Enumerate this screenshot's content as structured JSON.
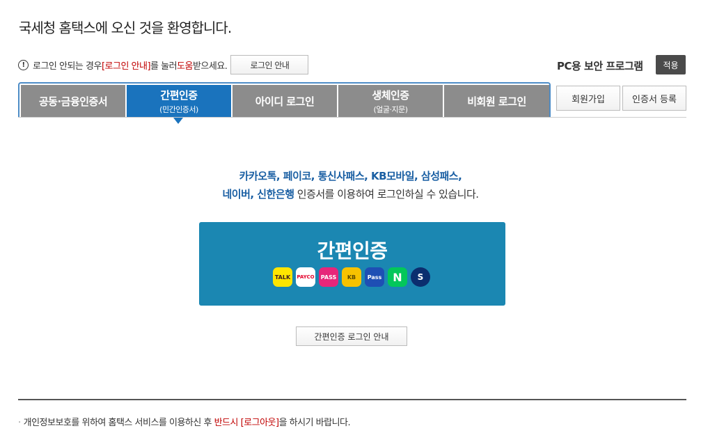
{
  "title": "국세청 홈택스에 오신 것을 환영합니다.",
  "help": {
    "text_1": "로그인 안되는 경우 ",
    "link_login_guide": "[로그인 안내]",
    "text_2": "를 눌러 ",
    "link_help": "도움",
    "text_3": "받으세요.",
    "button": "로그인 안내"
  },
  "security": {
    "label": "PC용 보안 프로그램",
    "button": "적용"
  },
  "tabs": [
    {
      "label": "공동·금융인증서",
      "sub": ""
    },
    {
      "label": "간편인증",
      "sub": "(민간인증서)"
    },
    {
      "label": "아이디 로그인",
      "sub": ""
    },
    {
      "label": "생체인증",
      "sub": "(얼굴·지문)"
    },
    {
      "label": "비회원 로그인",
      "sub": ""
    }
  ],
  "right_buttons": {
    "signup": "회원가입",
    "cert_register": "인증서 등록"
  },
  "description": {
    "providers_line1": "카카오톡, 페이코, 통신사패스, KB모바일, 삼성패스,",
    "providers_line2": "네이버, 신한은행",
    "suffix": " 인증서를 이용하여 로그인하실 수 있습니다."
  },
  "main_button": {
    "label": "간편인증",
    "logos": [
      {
        "name": "kakao-talk",
        "text": "TALK",
        "bg": "#fee500",
        "fg": "#3c1e1e"
      },
      {
        "name": "payco",
        "text": "PAYCO",
        "bg": "#ffffff",
        "fg": "#e4002b"
      },
      {
        "name": "pass",
        "text": "PASS",
        "bg": "#e6267a",
        "fg": "#ffffff"
      },
      {
        "name": "kb",
        "text": "KB",
        "bg": "#f7c200",
        "fg": "#5c4a00"
      },
      {
        "name": "samsung-pass",
        "text": "Pass",
        "bg": "#1e4fb4",
        "fg": "#ffffff"
      },
      {
        "name": "naver",
        "text": "N",
        "bg": "#03c75a",
        "fg": "#ffffff"
      },
      {
        "name": "shinhan",
        "text": "S",
        "bg": "#0b2e6f",
        "fg": "#ffffff"
      }
    ]
  },
  "guide_button": "간편인증 로그인 안내",
  "footer": {
    "text_1": "개인정보보호를 위하여 홈택스 서비스를 이용하신 후 ",
    "highlight_1": "반드시 ",
    "highlight_2": "[로그아웃]",
    "text_2": "을 하시기 바랍니다."
  },
  "colors": {
    "active_tab": "#1a73bd",
    "inactive_tab": "#8c8c8c",
    "main_button": "#1b87b2",
    "accent_red": "#c00000"
  }
}
